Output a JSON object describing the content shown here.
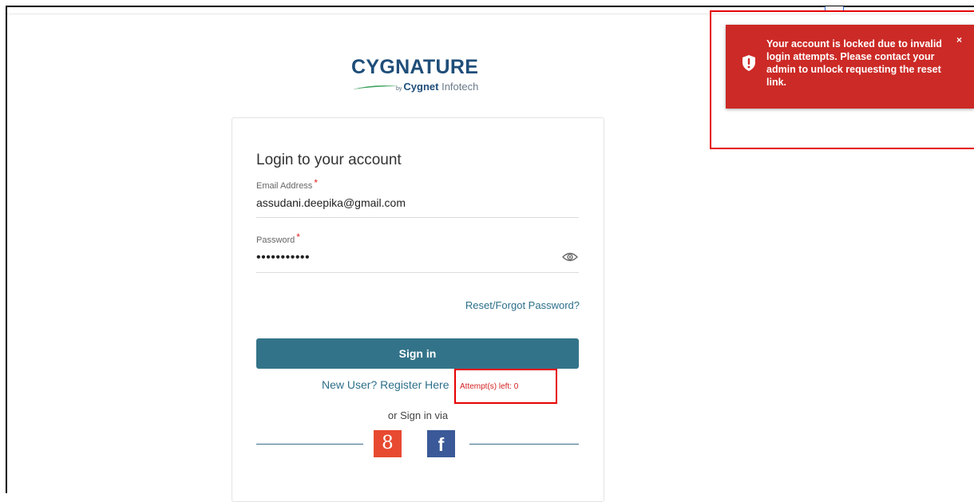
{
  "brand": {
    "name": "CYGNATURE",
    "by": "by",
    "company_bold": "Cygnet",
    "company_light": " Infotech"
  },
  "login": {
    "title": "Login to your account",
    "email_label": "Email Address",
    "email_value": "assudani.deepika@gmail.com",
    "password_label": "Password",
    "password_value": "•••••••••••",
    "required_mark": "*",
    "reset_link": "Reset/Forgot Password?",
    "signin_label": "Sign in",
    "register_link": "New User? Register Here",
    "attempts_left": "Attempt(s) left: 0",
    "or_sign_in_via": "or Sign in via",
    "google_glyph": "8",
    "facebook_glyph": "f"
  },
  "toast": {
    "message": "Your account is locked due to invalid login attempts. Please contact your admin to unlock requesting the reset link.",
    "close": "×",
    "icon": "shield-alert-icon"
  },
  "colors": {
    "primary": "#337389",
    "brand": "#1f4e79",
    "toast_bg": "#cc2a26",
    "highlight": "#e60000",
    "google": "#e74a31",
    "facebook": "#3b5998"
  }
}
